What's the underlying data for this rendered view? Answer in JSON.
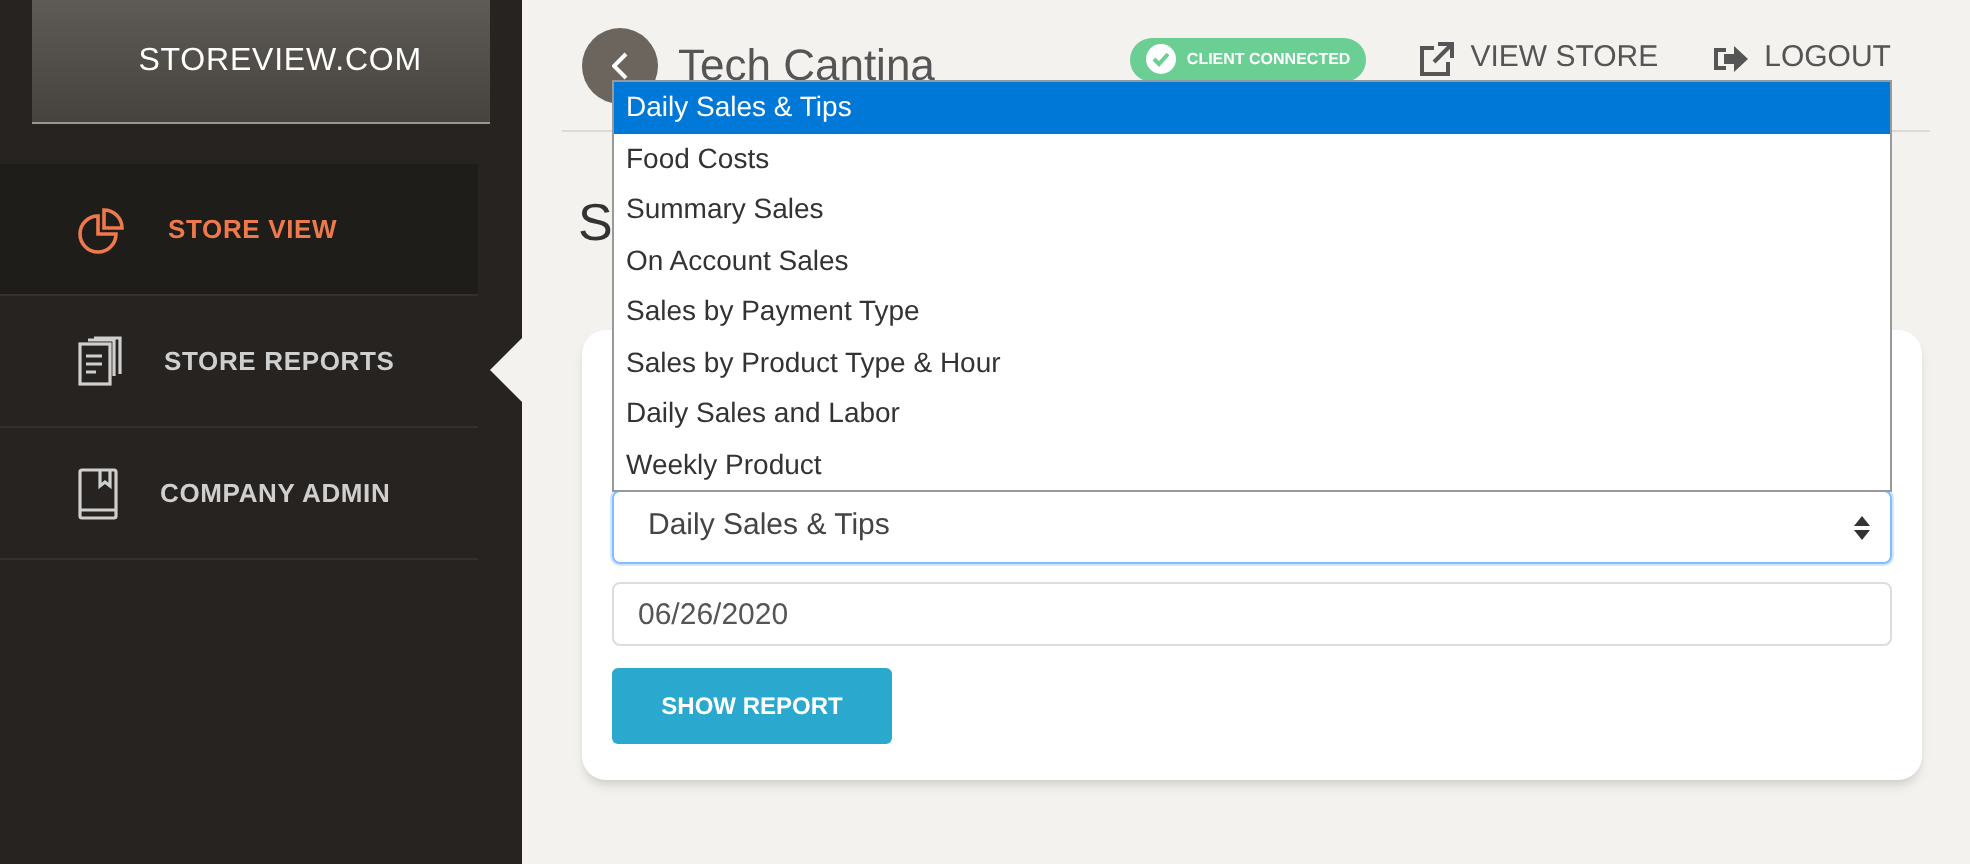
{
  "sidebar": {
    "brand": "STOREVIEW.COM",
    "items": [
      {
        "label": "STORE VIEW",
        "highlighted": true,
        "selected": false
      },
      {
        "label": "STORE REPORTS",
        "highlighted": false,
        "selected": true
      },
      {
        "label": "COMPANY ADMIN",
        "highlighted": false,
        "selected": false
      }
    ]
  },
  "header": {
    "store_name": "Tech Cantina",
    "status_badge": "CLIENT CONNECTED",
    "links": [
      {
        "label": "VIEW STORE"
      },
      {
        "label": "LOGOUT"
      }
    ]
  },
  "page_title": "S",
  "form": {
    "report_select": {
      "value": "Daily Sales & Tips",
      "expanded": true,
      "options": [
        {
          "label": "Daily Sales & Tips",
          "selected": true
        },
        {
          "label": "Food Costs",
          "selected": false
        },
        {
          "label": "Summary Sales",
          "selected": false
        },
        {
          "label": "On Account Sales",
          "selected": false
        },
        {
          "label": "Sales by Payment Type",
          "selected": false
        },
        {
          "label": "Sales by Product Type & Hour",
          "selected": false
        },
        {
          "label": "Daily Sales and Labor",
          "selected": false
        },
        {
          "label": "Weekly Product",
          "selected": false
        }
      ]
    },
    "date": "06/26/2020",
    "button": "SHOW REPORT"
  }
}
